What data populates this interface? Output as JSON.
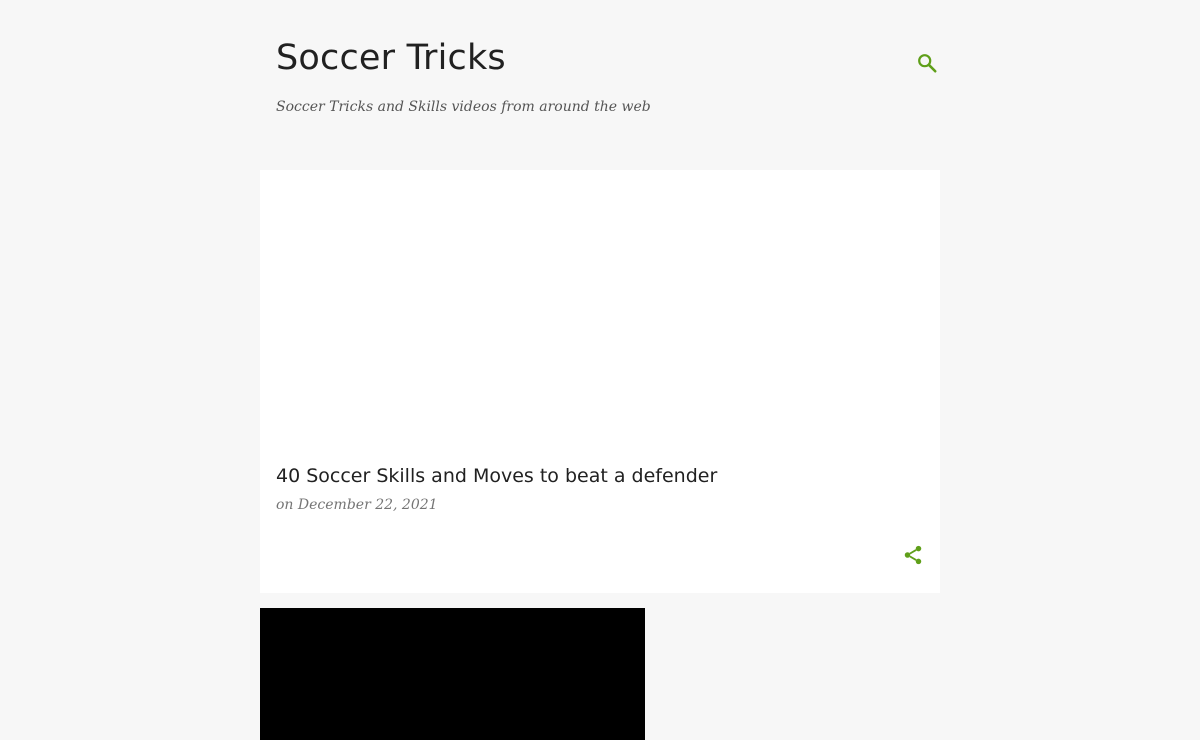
{
  "header": {
    "title": "Soccer Tricks",
    "description": "Soccer Tricks and Skills videos from around the web",
    "search_icon": "search-icon"
  },
  "post": {
    "title": "40 Soccer Skills and Moves to beat a defender",
    "date_prefix": "on",
    "date": "December 22, 2021",
    "share_icon": "share-icon"
  },
  "colors": {
    "accent": "#5f9f19",
    "background": "#f7f7f7",
    "card": "#ffffff",
    "video_placeholder": "#000000"
  }
}
